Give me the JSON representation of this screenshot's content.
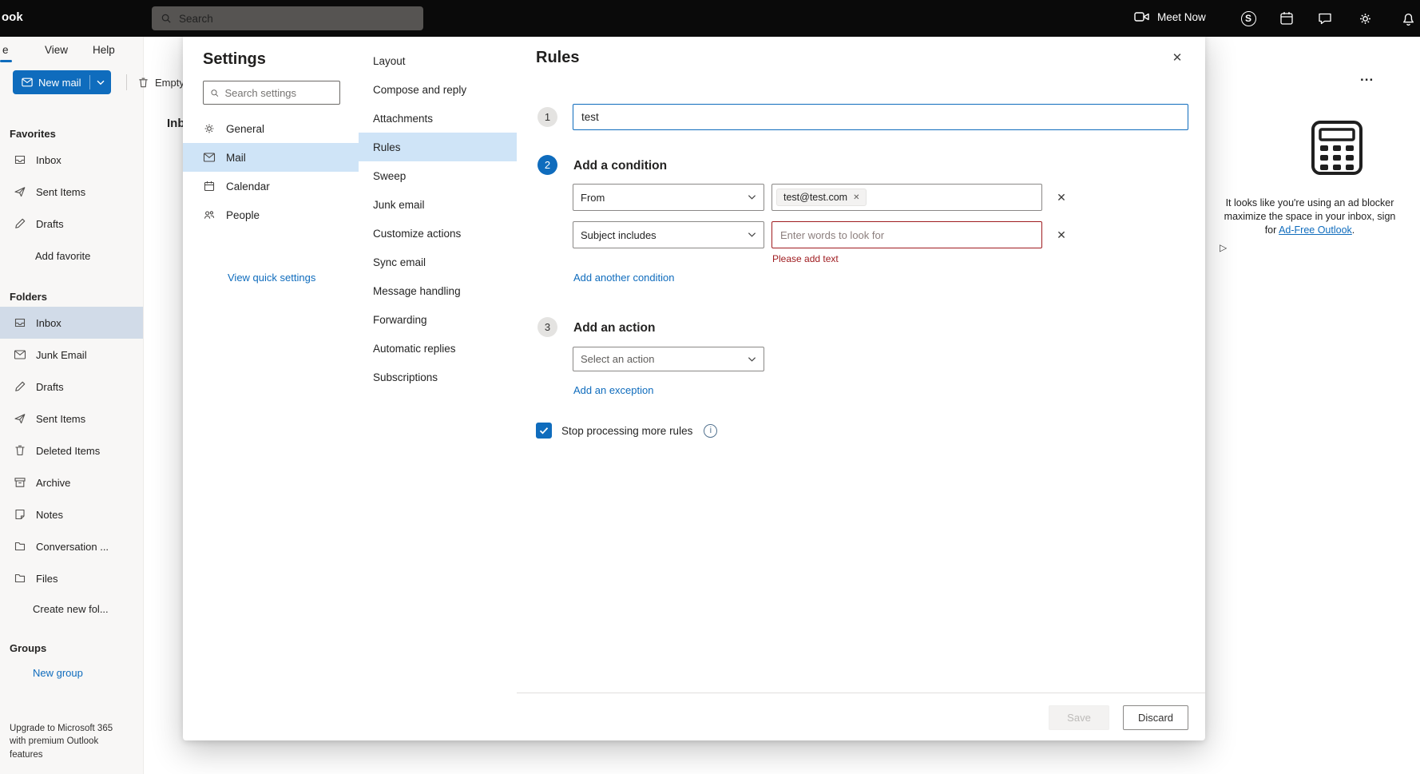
{
  "topbar": {
    "logo_text": "ook",
    "search_placeholder": "Search",
    "meet_now_label": "Meet Now"
  },
  "ribbon": {
    "tab_home": "e",
    "tab_view": "View",
    "tab_help": "Help",
    "new_mail_label": "New mail",
    "empty_label": "Empty"
  },
  "sidebar": {
    "favorites_heading": "Favorites",
    "favorites": [
      {
        "label": "Inbox"
      },
      {
        "label": "Sent Items"
      },
      {
        "label": "Drafts"
      }
    ],
    "add_favorite_label": "Add favorite",
    "folders_heading": "Folders",
    "folders": [
      {
        "label": "Inbox"
      },
      {
        "label": "Junk Email"
      },
      {
        "label": "Drafts"
      },
      {
        "label": "Sent Items"
      },
      {
        "label": "Deleted Items"
      },
      {
        "label": "Archive"
      },
      {
        "label": "Notes"
      },
      {
        "label": "Conversation ..."
      },
      {
        "label": "Files"
      }
    ],
    "create_folder_label": "Create new fol...",
    "groups_heading": "Groups",
    "new_group_label": "New group",
    "upgrade_text": "Upgrade to Microsoft 365 with premium Outlook features"
  },
  "main": {
    "list_title": "Inb",
    "more_options": "...",
    "ad": {
      "line1": "It looks like you're using an ad blocker",
      "line2": "maximize the space in your inbox, sign",
      "line3_before_link": "for ",
      "link_text": "Ad-Free Outlook",
      "line3_after_link": ".",
      "adchoices_glyph": "▷"
    }
  },
  "settings": {
    "title": "Settings",
    "search_placeholder": "Search settings",
    "nav": [
      {
        "label": "General"
      },
      {
        "label": "Mail"
      },
      {
        "label": "Calendar"
      },
      {
        "label": "People"
      }
    ],
    "quick_settings_link": "View quick settings",
    "mail_nav": [
      "Layout",
      "Compose and reply",
      "Attachments",
      "Rules",
      "Sweep",
      "Junk email",
      "Customize actions",
      "Sync email",
      "Message handling",
      "Forwarding",
      "Automatic replies",
      "Subscriptions"
    ]
  },
  "rules_panel": {
    "title": "Rules",
    "close_glyph": "✕",
    "step1_number": "1",
    "step2_number": "2",
    "step3_number": "3",
    "name_value": "test",
    "condition_heading": "Add a condition",
    "conditions": [
      {
        "selector": "From",
        "value_chip": "test@test.com",
        "chip_close": "✕",
        "remove_glyph": "✕"
      },
      {
        "selector": "Subject includes",
        "placeholder": "Enter words to look for",
        "error": "Please add text",
        "remove_glyph": "✕"
      }
    ],
    "add_condition_link": "Add another condition",
    "action_heading": "Add an action",
    "action_placeholder": "Select an action",
    "add_exception_link": "Add an exception",
    "stop_processing_label": "Stop processing more rules",
    "info_glyph": "i",
    "save_label": "Save",
    "discard_label": "Discard"
  },
  "colors": {
    "accent": "#0f6cbd",
    "selected_bg": "#cfe4f7",
    "error": "#9f1c20",
    "link": "#0f6cbd",
    "topbar_bg": "#0a0a0a"
  }
}
